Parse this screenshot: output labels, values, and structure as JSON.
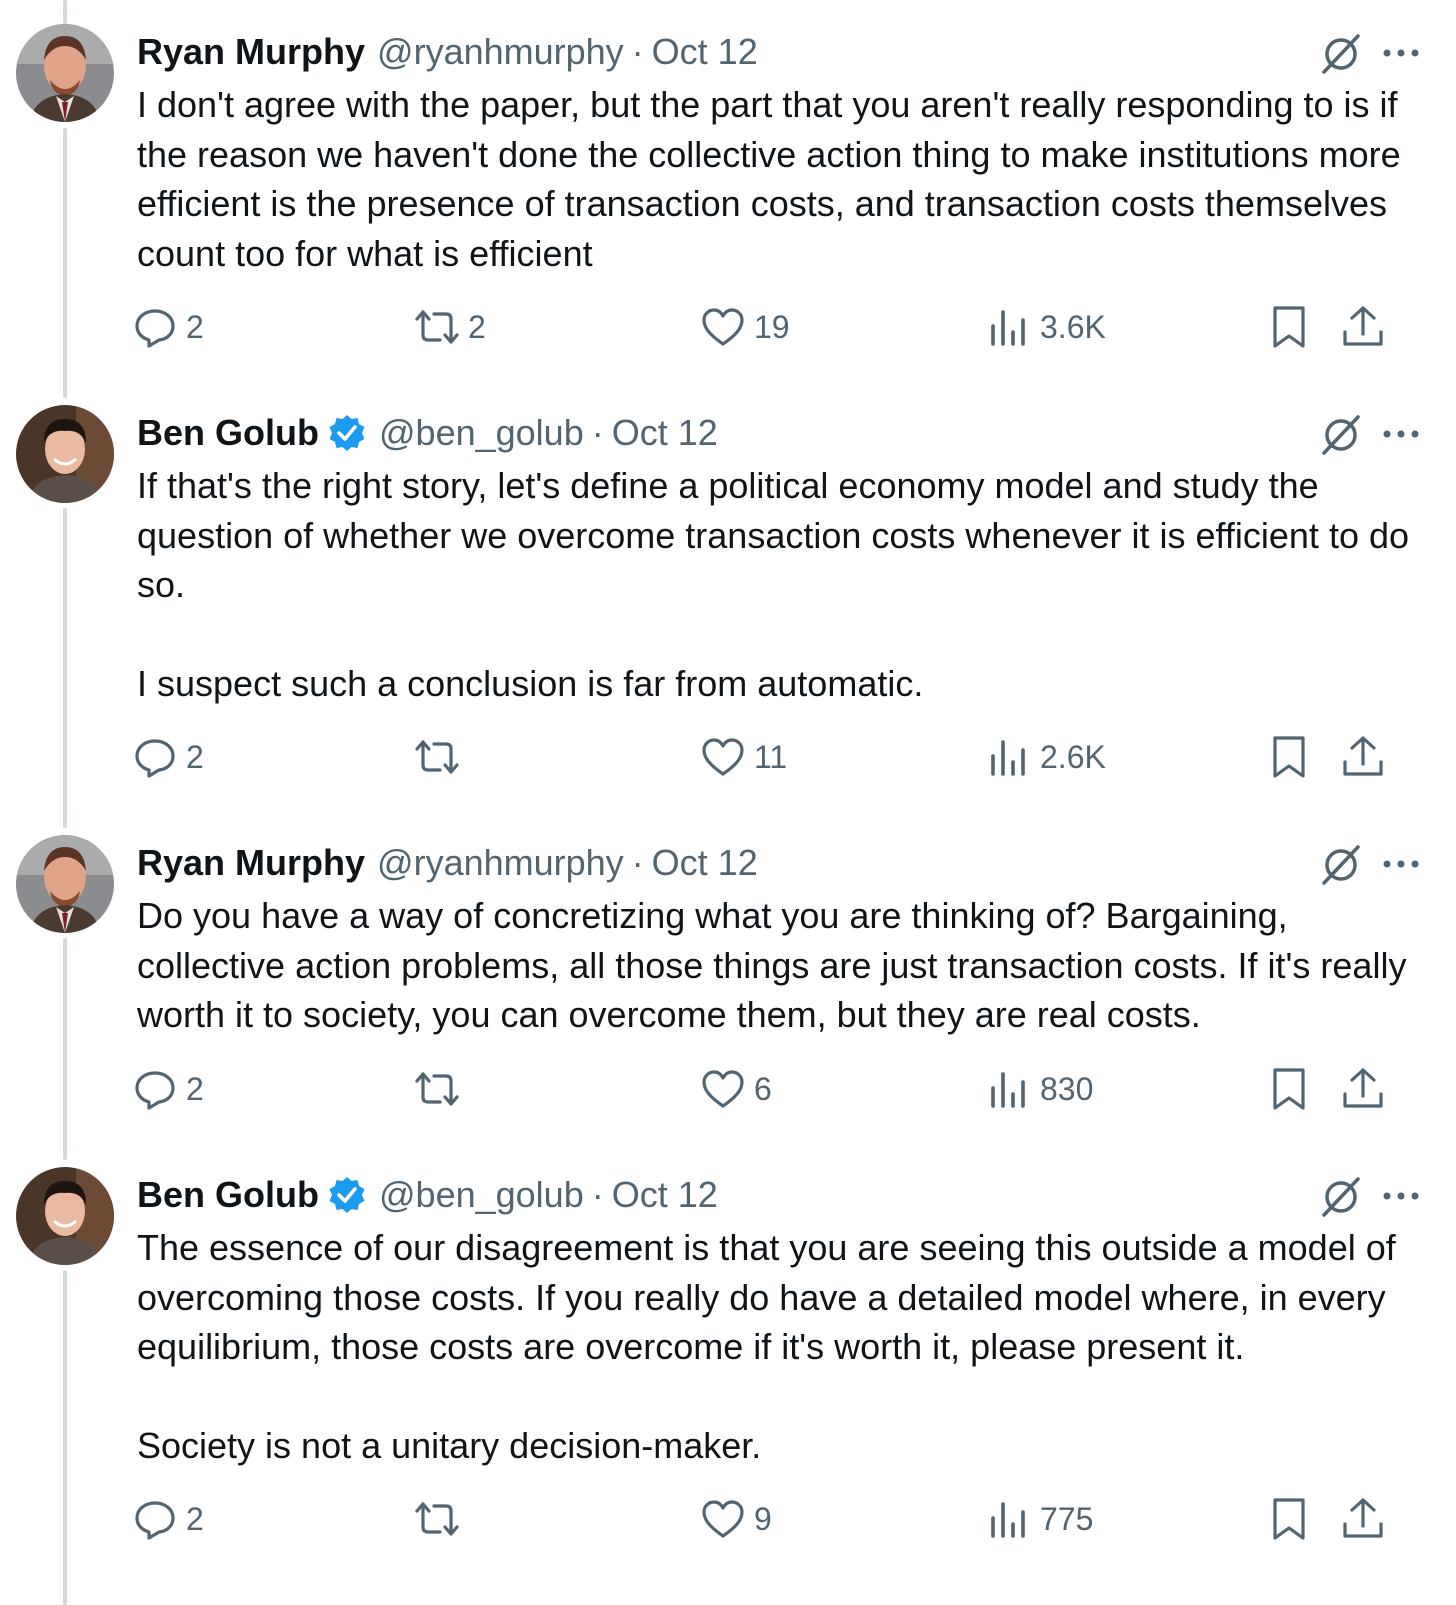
{
  "tweets": [
    {
      "author_name": "Ryan Murphy",
      "verified": false,
      "handle": "@ryanhmurphy",
      "separator": "·",
      "date": "Oct 12",
      "paragraphs": [
        "I don't agree with the paper, but the part that you aren't really responding to is if the reason we haven't done the collective action thing to make institutions more efficient is the presence of transaction costs, and transaction costs themselves count too for what is efficient"
      ],
      "replies": "2",
      "reposts": "2",
      "likes": "19",
      "views": "3.6K"
    },
    {
      "author_name": "Ben Golub",
      "verified": true,
      "handle": "@ben_golub",
      "separator": "·",
      "date": "Oct 12",
      "paragraphs": [
        "If that's the right story, let's define a political economy model and study the question of whether we overcome transaction costs whenever it is efficient to do so.",
        "I suspect such a conclusion is far from automatic."
      ],
      "replies": "2",
      "reposts": "",
      "likes": "11",
      "views": "2.6K"
    },
    {
      "author_name": "Ryan Murphy",
      "verified": false,
      "handle": "@ryanhmurphy",
      "separator": "·",
      "date": "Oct 12",
      "paragraphs": [
        "Do you have a way of concretizing what you are thinking of? Bargaining, collective action problems, all those things are just transaction costs. If it's really worth it to society, you can overcome them, but they are real costs."
      ],
      "replies": "2",
      "reposts": "",
      "likes": "6",
      "views": "830"
    },
    {
      "author_name": "Ben Golub",
      "verified": true,
      "handle": "@ben_golub",
      "separator": "·",
      "date": "Oct 12",
      "paragraphs": [
        "The essence of our disagreement is that you are seeing this outside a model of overcoming those costs. If you really do have a detailed model where, in every equilibrium, those costs are overcome if it's worth it, please present it.",
        "Society is not a unitary decision-maker."
      ],
      "replies": "2",
      "reposts": "",
      "likes": "9",
      "views": "775"
    }
  ],
  "icons": {
    "reply": "reply-icon",
    "repost": "repost-icon",
    "like": "heart-icon",
    "views": "views-icon",
    "bookmark": "bookmark-icon",
    "share": "share-icon",
    "grok": "grok-icon",
    "more": "more-icon",
    "verified": "verified-badge-icon"
  },
  "colors": {
    "text": "#0f1419",
    "secondary": "#536471",
    "verified_blue": "#1d9bf0",
    "thread_line": "#cfd9de"
  }
}
